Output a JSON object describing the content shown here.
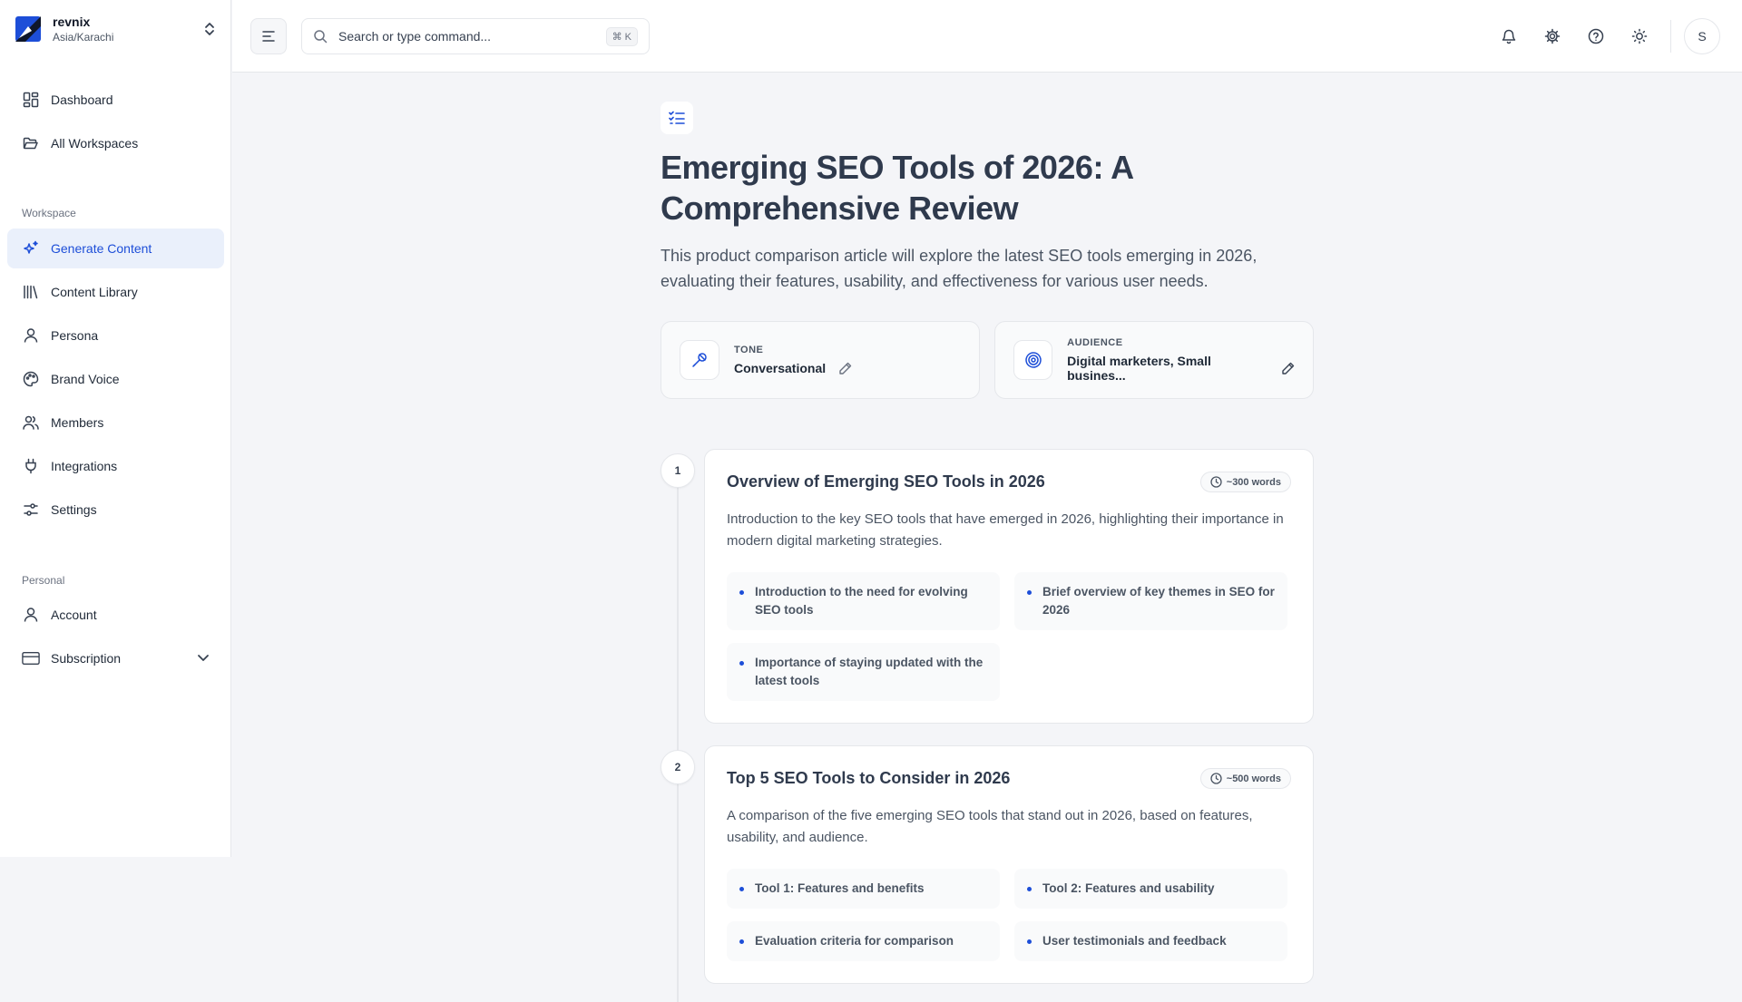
{
  "org": {
    "name": "revnix",
    "timezone": "Asia/Karachi"
  },
  "nav_top": [
    {
      "label": "Dashboard",
      "icon": "dashboard-icon"
    },
    {
      "label": "All Workspaces",
      "icon": "folder-open-icon"
    }
  ],
  "workspace_section": {
    "label": "Workspace",
    "items": [
      {
        "label": "Generate Content",
        "icon": "sparkles-icon",
        "active": true
      },
      {
        "label": "Content Library",
        "icon": "library-icon"
      },
      {
        "label": "Persona",
        "icon": "user-icon"
      },
      {
        "label": "Brand Voice",
        "icon": "palette-icon"
      },
      {
        "label": "Members",
        "icon": "users-icon"
      },
      {
        "label": "Integrations",
        "icon": "plug-icon"
      },
      {
        "label": "Settings",
        "icon": "sliders-icon"
      }
    ]
  },
  "personal_section": {
    "label": "Personal",
    "items": [
      {
        "label": "Account",
        "icon": "user-icon"
      },
      {
        "label": "Subscription",
        "icon": "credit-card-icon"
      }
    ]
  },
  "search": {
    "placeholder": "Search or type command...",
    "shortcut": "⌘ K"
  },
  "user": {
    "initial": "S"
  },
  "colors": {
    "accent": "#1d4ed8",
    "active_bg": "#eaf0fb",
    "page_bg": "#f4f5f8"
  },
  "article": {
    "title": "Emerging SEO Tools of 2026: A Comprehensive Review",
    "description": "This product comparison article will explore the latest SEO tools emerging in 2026, evaluating their features, usability, and effectiveness for various user needs.",
    "tone": {
      "label": "TONE",
      "value": "Conversational"
    },
    "audience": {
      "label": "AUDIENCE",
      "value": "Digital marketers, Small busines..."
    }
  },
  "sections": [
    {
      "number": "1",
      "title": "Overview of Emerging SEO Tools in 2026",
      "words": "~300 words",
      "description": "Introduction to the key SEO tools that have emerged in 2026, highlighting their importance in modern digital marketing strategies.",
      "points": [
        "Introduction to the need for evolving SEO tools",
        "Brief overview of key themes in SEO for 2026",
        "Importance of staying updated with the latest tools"
      ]
    },
    {
      "number": "2",
      "title": "Top 5 SEO Tools to Consider in 2026",
      "words": "~500 words",
      "description": "A comparison of the five emerging SEO tools that stand out in 2026, based on features, usability, and audience.",
      "points": [
        "Tool 1: Features and benefits",
        "Tool 2: Features and usability",
        "Evaluation criteria for comparison",
        "User testimonials and feedback"
      ]
    }
  ]
}
